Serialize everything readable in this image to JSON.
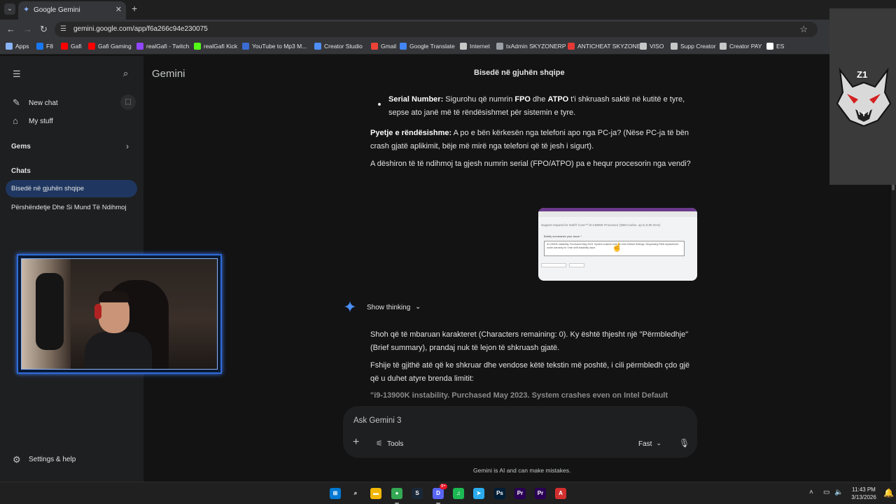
{
  "browser": {
    "tab_title": "Google Gemini",
    "tab_close": "✕",
    "new_tab": "+",
    "url": "gemini.google.com/app/f6a266c94e230075",
    "bookmarks": [
      {
        "label": "Apps",
        "color": "#8ab4f8"
      },
      {
        "label": "F8",
        "color": "#1877f2"
      },
      {
        "label": "Gafi",
        "color": "#ff0000"
      },
      {
        "label": "Gafi Gaming",
        "color": "#ff0000"
      },
      {
        "label": "realGafi - Twitch",
        "color": "#9146ff"
      },
      {
        "label": "realGafi Kick",
        "color": "#53fc18"
      },
      {
        "label": "YouTube to Mp3 M...",
        "color": "#3b6cd4"
      },
      {
        "label": "Creator Studio",
        "color": "#4f8ef7"
      },
      {
        "label": "Gmail",
        "color": "#ea4335"
      },
      {
        "label": "Google Translate",
        "color": "#4285f4"
      },
      {
        "label": "Internet",
        "color": "#c7c7c7"
      },
      {
        "label": "txAdmin SKYZONERP",
        "color": "#9aa0a6"
      },
      {
        "label": "ANTICHEAT SKYZONE",
        "color": "#e53935"
      },
      {
        "label": "VISO",
        "color": "#c7c7c7"
      },
      {
        "label": "Supp Creator",
        "color": "#c7c7c7"
      },
      {
        "label": "Creator PAY",
        "color": "#c7c7c7"
      },
      {
        "label": "ES",
        "color": "#ffffff"
      }
    ]
  },
  "sidebar": {
    "new_chat": "New chat",
    "my_stuff": "My stuff",
    "gems": "Gems",
    "chats_title": "Chats",
    "chats": [
      {
        "label": "Bisedë në gjuhën shqipe",
        "active": true
      },
      {
        "label": "Përshëndetje Dhe Si Mund Të Ndihmoj",
        "active": false
      }
    ],
    "settings": "Settings & help"
  },
  "main": {
    "brand": "Gemini",
    "title": "Bisedë në gjuhën shqipe",
    "bullet": {
      "label": "Serial Number:",
      "t1": " Sigurohu që numrin ",
      "fpo": "FPO",
      "t2": " dhe ",
      "atpo": "ATPO",
      "t3": " t'i shkruash saktë në kutitë e tyre, sepse ato janë më të rëndësishmet për sistemin e tyre."
    },
    "important": {
      "label": "Pyetje e rëndësishme:",
      "text": " A po e bën kërkesën nga telefoni apo nga PC-ja? (Nëse PC-ja të bën crash gjatë aplikimit, bëje më mirë nga telefoni që të jesh i sigurt)."
    },
    "question": "A dëshiron të të ndihmoj ta gjesh numrin serial (FPO/ATPO) pa e hequr procesorin nga vendi?",
    "attachment": {
      "heading": "Support request for Intel® Core™ i9-13900K Processor (36M Cache, up to 5.80 GHz)",
      "label": "Briefly summarize your issue *",
      "text": "i9-13900K instability. Purchased May 2023. System crashes even on Intel Default Settings. Requesting RMA replacement under warranty for Vmin shift instability issue."
    },
    "show_thinking": "Show thinking",
    "p1": "Shoh që të mbaruan karakteret (Characters remaining: 0). Ky është thjesht një \"Përmbledhje\" (Brief summary), prandaj nuk të lejon të shkruash gjatë.",
    "p2": "Fshije të gjithë atë që ke shkruar dhe vendose këtë tekstin më poshtë, i cili përmbledh çdo gjë që u duhet atyre brenda limitit:",
    "p3": "\"i9-13900K instability. Purchased May 2023. System crashes even on Intel Default",
    "composer": {
      "placeholder": "Ask Gemini 3",
      "tools": "Tools",
      "mode": "Fast"
    },
    "disclaimer": "Gemini is AI and can make mistakes."
  },
  "overlay": {
    "logo_text": "Z1"
  },
  "taskbar": {
    "time": "11:43 PM",
    "date": "3/13/2026",
    "apps": [
      {
        "name": "start",
        "glyph": "⊞",
        "color": "#0078d4"
      },
      {
        "name": "search",
        "glyph": "⌕",
        "color": "#202020"
      },
      {
        "name": "explorer",
        "glyph": "▬",
        "color": "#f2b705"
      },
      {
        "name": "chrome",
        "glyph": "●",
        "color": "#34a853"
      },
      {
        "name": "steam",
        "glyph": "S",
        "color": "#1b2838"
      },
      {
        "name": "discord",
        "glyph": "D",
        "color": "#5865f2"
      },
      {
        "name": "spotify",
        "glyph": "♫",
        "color": "#1db954"
      },
      {
        "name": "telegram",
        "glyph": "➤",
        "color": "#2aabee"
      },
      {
        "name": "photoshop",
        "glyph": "Ps",
        "color": "#001e36"
      },
      {
        "name": "premiere-1",
        "glyph": "Pr",
        "color": "#2a0055"
      },
      {
        "name": "premiere-2",
        "glyph": "Pr",
        "color": "#2a0055"
      },
      {
        "name": "acrobat",
        "glyph": "A",
        "color": "#d32f2f"
      }
    ],
    "discord_badge": "9+"
  }
}
